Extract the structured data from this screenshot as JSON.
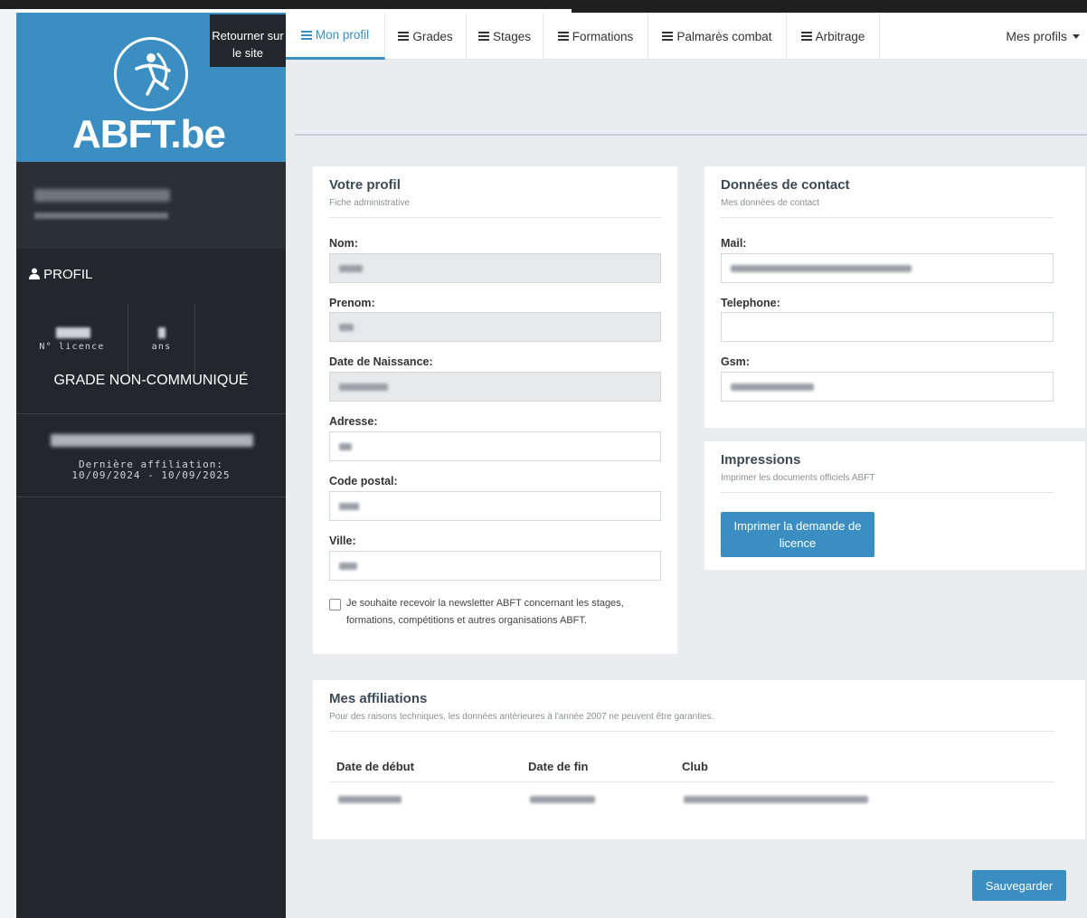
{
  "sidebar": {
    "return_link": "Retourner sur le site",
    "logo_text": "ABFT.be",
    "profil_heading": "PROFIL",
    "licence_label": "N° licence",
    "age_label": "ans",
    "grade": "GRADE NON-COMMUNIQUÉ",
    "affiliation_label": "Dernière affiliation:",
    "affiliation_dates": "10/09/2024 - 10/09/2025"
  },
  "nav": {
    "items": [
      {
        "label": "Mon profil"
      },
      {
        "label": "Grades"
      },
      {
        "label": "Stages"
      },
      {
        "label": "Formations"
      },
      {
        "label": "Palmarès combat"
      },
      {
        "label": "Arbitrage"
      }
    ],
    "profiles_menu": "Mes profils"
  },
  "profile": {
    "title": "Votre profil",
    "subtitle": "Fiche administrative",
    "fields": {
      "nom": "Nom:",
      "prenom": "Prenom:",
      "naissance": "Date de Naissance:",
      "adresse": "Adresse:",
      "code_postal": "Code postal:",
      "ville": "Ville:"
    },
    "newsletter": "Je souhaite recevoir la newsletter ABFT concernant les stages, formations, compétitions et autres organisations ABFT."
  },
  "contact": {
    "title": "Données de contact",
    "subtitle": "Mes données de contact",
    "mail": "Mail:",
    "telephone": "Telephone:",
    "gsm": "Gsm:"
  },
  "impressions": {
    "title": "Impressions",
    "subtitle": "Imprimer les documents officiels ABFT",
    "button": "Imprimer la demande de licence"
  },
  "affiliations": {
    "title": "Mes affiliations",
    "subtitle": "Pour des raisons techniques, les données antérieures à l'année 2007 ne peuvent être garanties.",
    "columns": [
      "Date de début",
      "Date de fin",
      "Club"
    ]
  },
  "save_button": "Sauvegarder",
  "colors": {
    "brand_blue": "#3a8ec2",
    "sidebar_dark": "#23272b"
  }
}
